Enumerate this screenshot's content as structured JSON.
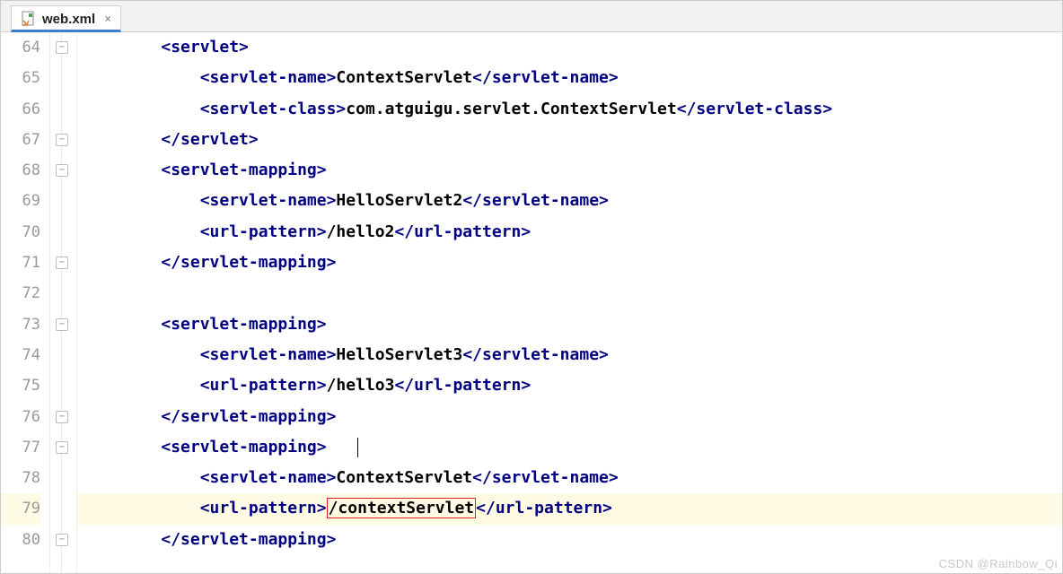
{
  "tab": {
    "filename": "web.xml",
    "close_glyph": "×"
  },
  "gutter": {
    "start": 64,
    "end": 80
  },
  "code": {
    "lines": [
      {
        "indent": 1,
        "parts": [
          {
            "t": "tag",
            "v": "<servlet>"
          }
        ]
      },
      {
        "indent": 2,
        "parts": [
          {
            "t": "tag",
            "v": "<servlet-name>"
          },
          {
            "t": "text",
            "v": "ContextServlet"
          },
          {
            "t": "tag",
            "v": "</servlet-name>"
          }
        ]
      },
      {
        "indent": 2,
        "parts": [
          {
            "t": "tag",
            "v": "<servlet-class>"
          },
          {
            "t": "text",
            "v": "com.atguigu.servlet.ContextServlet"
          },
          {
            "t": "tag",
            "v": "</servlet-class>"
          }
        ]
      },
      {
        "indent": 1,
        "parts": [
          {
            "t": "tag",
            "v": "</servlet>"
          }
        ]
      },
      {
        "indent": 1,
        "parts": [
          {
            "t": "tag",
            "v": "<servlet-mapping>"
          }
        ]
      },
      {
        "indent": 2,
        "parts": [
          {
            "t": "tag",
            "v": "<servlet-name>"
          },
          {
            "t": "text",
            "v": "HelloServlet2"
          },
          {
            "t": "tag",
            "v": "</servlet-name>"
          }
        ]
      },
      {
        "indent": 2,
        "parts": [
          {
            "t": "tag",
            "v": "<url-pattern>"
          },
          {
            "t": "text",
            "v": "/hello2"
          },
          {
            "t": "tag",
            "v": "</url-pattern>"
          }
        ]
      },
      {
        "indent": 1,
        "parts": [
          {
            "t": "tag",
            "v": "</servlet-mapping>"
          }
        ]
      },
      {
        "indent": 0,
        "parts": []
      },
      {
        "indent": 1,
        "parts": [
          {
            "t": "tag",
            "v": "<servlet-mapping>"
          }
        ]
      },
      {
        "indent": 2,
        "parts": [
          {
            "t": "tag",
            "v": "<servlet-name>"
          },
          {
            "t": "text",
            "v": "HelloServlet3"
          },
          {
            "t": "tag",
            "v": "</servlet-name>"
          }
        ]
      },
      {
        "indent": 2,
        "parts": [
          {
            "t": "tag",
            "v": "<url-pattern>"
          },
          {
            "t": "text",
            "v": "/hello3"
          },
          {
            "t": "tag",
            "v": "</url-pattern>"
          }
        ]
      },
      {
        "indent": 1,
        "parts": [
          {
            "t": "tag",
            "v": "</servlet-mapping>"
          }
        ]
      },
      {
        "indent": 1,
        "parts": [
          {
            "t": "tag",
            "v": "<servlet-mapping>"
          }
        ],
        "caret_after": true
      },
      {
        "indent": 2,
        "parts": [
          {
            "t": "tag",
            "v": "<servlet-name>"
          },
          {
            "t": "text",
            "v": "ContextServlet"
          },
          {
            "t": "tag",
            "v": "</servlet-name>"
          }
        ]
      },
      {
        "indent": 2,
        "hl": true,
        "parts": [
          {
            "t": "tag",
            "v": "<url-pattern>"
          },
          {
            "t": "text",
            "v": "/contextServlet",
            "box": true
          },
          {
            "t": "tag",
            "v": "</url-pattern>"
          }
        ]
      },
      {
        "indent": 1,
        "parts": [
          {
            "t": "tag",
            "v": "</servlet-mapping>"
          }
        ]
      }
    ]
  },
  "fold_marks": [
    0,
    3,
    4,
    7,
    9,
    12,
    13,
    16
  ],
  "watermark": "CSDN @Rainbow_Qi"
}
